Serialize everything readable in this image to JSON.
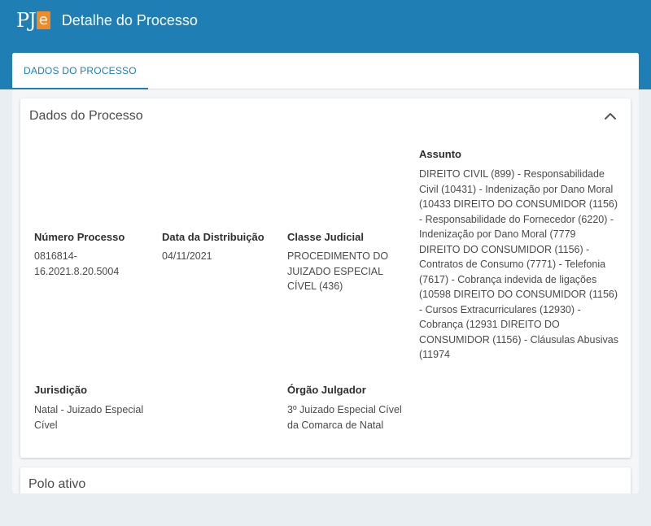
{
  "header": {
    "logo_text": "PJ",
    "logo_e": "e",
    "title": "Detalhe do Processo"
  },
  "tabs": [
    {
      "label": "DADOS DO PROCESSO",
      "active": true
    }
  ],
  "section": {
    "title": "Dados do Processo",
    "toggle_icon": "chevron-up-icon",
    "fields": {
      "numero": {
        "label": "Número Processo",
        "value": "0816814-16.2021.8.20.5004"
      },
      "data_distribuicao": {
        "label": "Data da Distribuição",
        "value": "04/11/2021"
      },
      "classe": {
        "label": "Classe Judicial",
        "value": "PROCEDIMENTO DO JUIZADO ESPECIAL CÍVEL (436)"
      },
      "assunto": {
        "label": "Assunto",
        "value": "DIREITO CIVIL (899) - Responsabilidade Civil (10431) - Indenização por Dano Moral (10433 DIREITO DO CONSUMIDOR (1156) - Responsabilidade do Fornecedor (6220) - Indenização por Dano Moral (7779 DIREITO DO CONSUMIDOR (1156) - Contratos de Consumo (7771) - Telefonia (7617) - Cobrança indevida de ligações (10598 DIREITO DO CONSUMIDOR (1156) - Cursos Extracurriculares (12930) - Cobrança (12931 DIREITO DO CONSUMIDOR (1156) - Cláusulas Abusivas (11974"
      },
      "jurisdicao": {
        "label": "Jurisdição",
        "value": "Natal - Juizado Especial Cível"
      },
      "orgao": {
        "label": "Órgão Julgador",
        "value": "3º Juizado Especial Cível da Comarca de Natal"
      }
    }
  },
  "section2": {
    "title": "Polo ativo"
  },
  "colors": {
    "brand_blue": "#1f7eb3",
    "logo_orange": "#f08a24",
    "background": "#e9eef2"
  }
}
